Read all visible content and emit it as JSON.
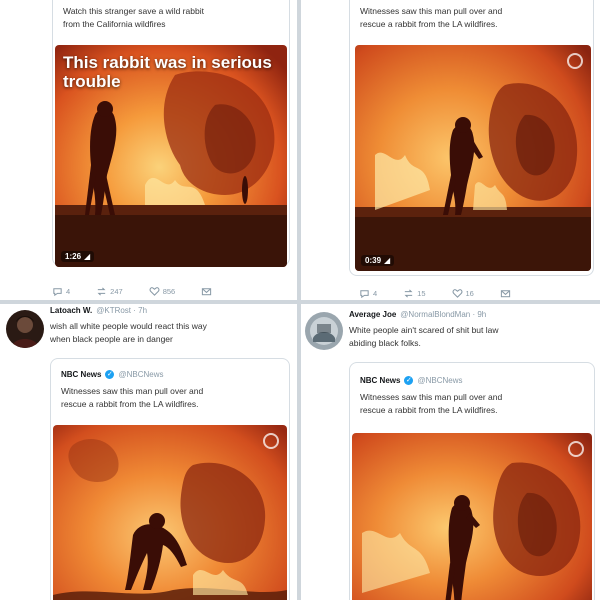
{
  "panels": {
    "top_left": {
      "quote": {
        "text_lines": [
          "Watch this stranger save a wild rabbit",
          "from the California wildfires"
        ]
      },
      "media": {
        "caption": "This rabbit was in serious trouble",
        "duration": "1:26"
      },
      "actions": {
        "reply": "4",
        "retweet": "247",
        "like": "856"
      }
    },
    "top_right": {
      "quote": {
        "text_lines": [
          "Witnesses saw this man pull over and",
          "rescue a rabbit from the LA wildfires."
        ]
      },
      "media": {
        "duration": "0:39"
      },
      "actions": {
        "reply": "4",
        "retweet": "15",
        "like": "16"
      }
    },
    "bottom_left": {
      "tweet": {
        "name": "Latoach W.",
        "handle": "@KTRost · 7h",
        "text_lines": [
          "wish all white people would react this way",
          "when black people are in danger"
        ]
      },
      "quote": {
        "name": "NBC News",
        "handle": "@NBCNews",
        "text_lines": [
          "Witnesses saw this man pull over and",
          "rescue a rabbit from the LA wildfires."
        ]
      }
    },
    "bottom_right": {
      "tweet": {
        "name": "Average Joe",
        "handle": "@NormalBlondMan · 9h",
        "text_lines": [
          "White people ain't scared of shit but law",
          "abiding black folks."
        ]
      },
      "quote": {
        "name": "NBC News",
        "handle": "@NBCNews",
        "text_lines": [
          "Witnesses saw this man pull over and",
          "rescue a rabbit from the LA wildfires."
        ]
      }
    }
  },
  "icons": {
    "reply": "reply-icon",
    "retweet": "retweet-icon",
    "like": "heart-icon",
    "dm": "envelope-icon",
    "verified": "verified-badge-icon"
  },
  "colors": {
    "fire_light": "#f7a43a",
    "fire_mid": "#e8612a",
    "fire_dark": "#b4331a",
    "silhouette": "#3a0d06",
    "verified": "#1da1f2"
  }
}
